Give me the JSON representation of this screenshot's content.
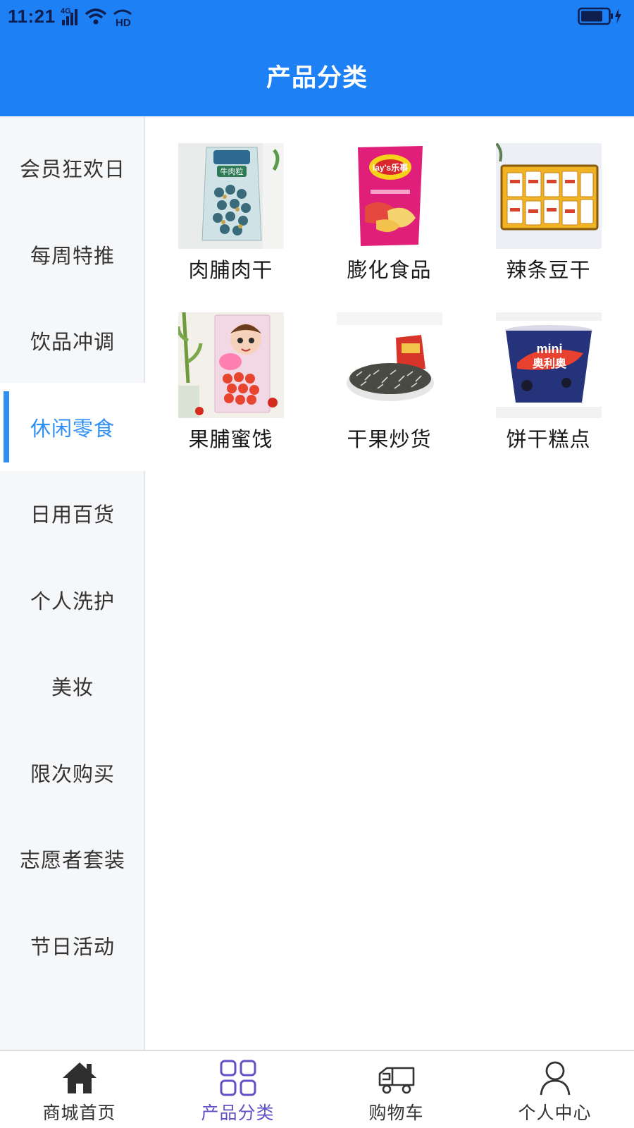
{
  "status": {
    "time": "11:21",
    "network": "4G",
    "hd": "HD"
  },
  "header": {
    "title": "产品分类"
  },
  "colors": {
    "brand_blue": "#1e80f5",
    "active_blue": "#2d8ef3",
    "tab_active": "#6252c7"
  },
  "sidebar": {
    "items": [
      {
        "label": "会员狂欢日",
        "active": false
      },
      {
        "label": "每周特推",
        "active": false
      },
      {
        "label": "饮品冲调",
        "active": false
      },
      {
        "label": "休闲零食",
        "active": true
      },
      {
        "label": "日用百货",
        "active": false
      },
      {
        "label": "个人洗护",
        "active": false
      },
      {
        "label": "美妆",
        "active": false
      },
      {
        "label": "限次购买",
        "active": false
      },
      {
        "label": "志愿者套装",
        "active": false
      },
      {
        "label": "节日活动",
        "active": false
      }
    ]
  },
  "products": [
    {
      "label": "肉脯肉干",
      "image": "beef-jerky-bag-image"
    },
    {
      "label": "膨化食品",
      "image": "potato-chips-bag-image"
    },
    {
      "label": "辣条豆干",
      "image": "spicy-strips-box-image"
    },
    {
      "label": "果脯蜜饯",
      "image": "dried-fruit-bag-image"
    },
    {
      "label": "干果炒货",
      "image": "sunflower-seeds-image"
    },
    {
      "label": "饼干糕点",
      "image": "mini-oreo-cup-image"
    }
  ],
  "tabs": [
    {
      "label": "商城首页",
      "icon": "home-icon",
      "active": false
    },
    {
      "label": "产品分类",
      "icon": "grid-icon",
      "active": true
    },
    {
      "label": "购物车",
      "icon": "cart-truck-icon",
      "active": false
    },
    {
      "label": "个人中心",
      "icon": "user-icon",
      "active": false
    }
  ]
}
